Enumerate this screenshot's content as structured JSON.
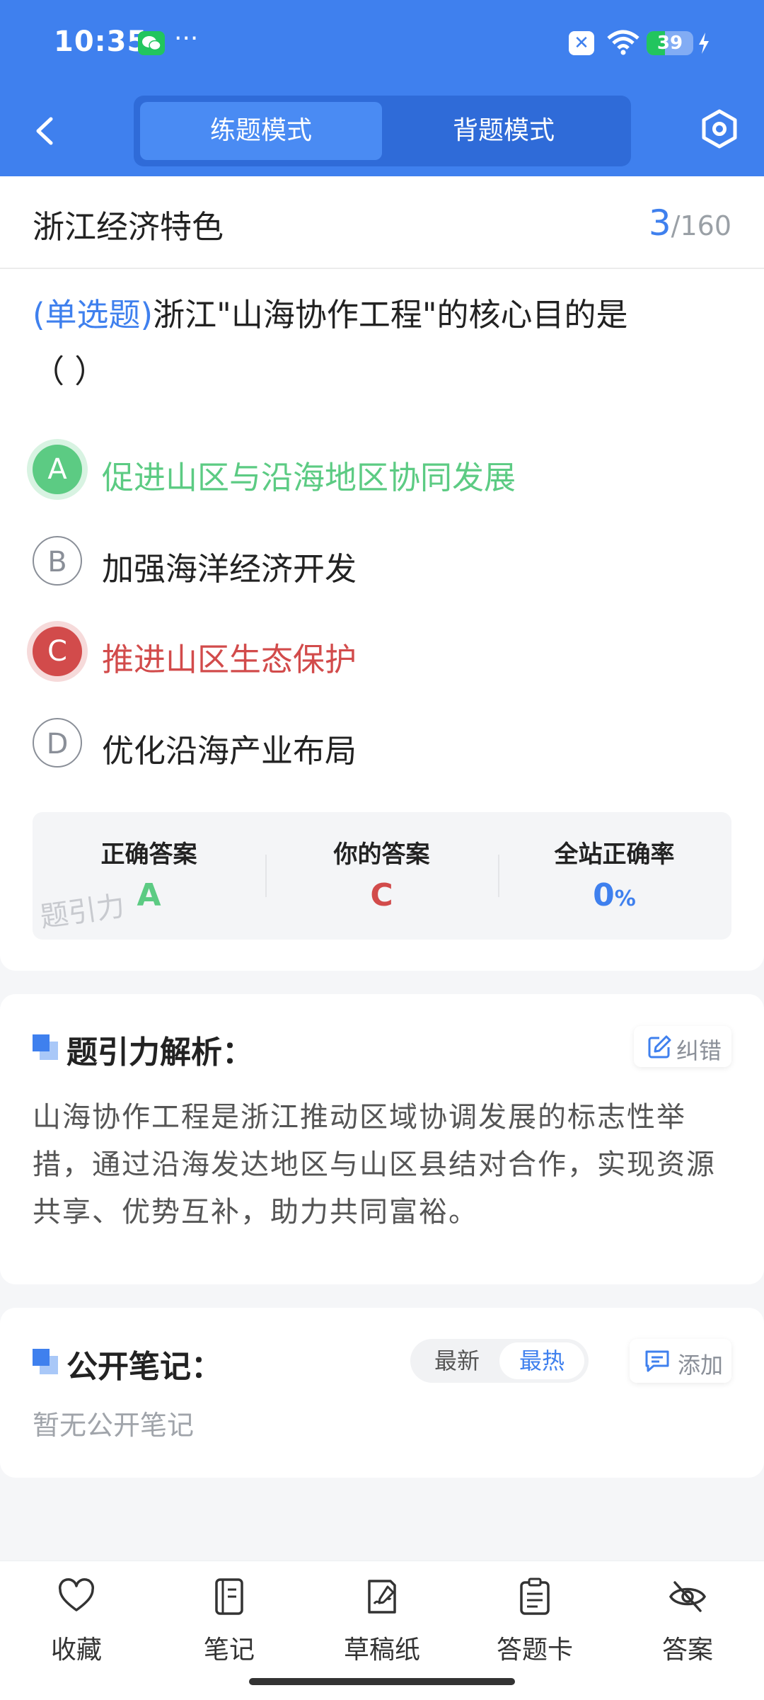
{
  "status_bar": {
    "time": "10:35",
    "battery_level": "39",
    "battery_percent": 39,
    "icons": [
      "wechat-icon",
      "more-dots-icon",
      "close-badge-icon",
      "wifi-icon",
      "battery-icon",
      "charging-bolt-icon"
    ]
  },
  "header": {
    "back_icon": "chevron-left-icon",
    "mode_tabs": [
      {
        "label": "练题模式",
        "active": true
      },
      {
        "label": "背题模式",
        "active": false
      }
    ],
    "settings_icon": "hexagon-settings-icon"
  },
  "chapter": {
    "title": "浙江经济特色",
    "current": "3",
    "separator": "/",
    "total": "160"
  },
  "question": {
    "type_label": "(单选题)",
    "text_line1": "浙江\"山海协作工程\"的核心目的是",
    "text_line2": "（        ）",
    "options": [
      {
        "letter": "A",
        "text": "促进山区与沿海地区协同发展",
        "state": "correct"
      },
      {
        "letter": "B",
        "text": "加强海洋经济开发",
        "state": "normal"
      },
      {
        "letter": "C",
        "text": "推进山区生态保护",
        "state": "wrong"
      },
      {
        "letter": "D",
        "text": "优化沿海产业布局",
        "state": "normal"
      }
    ]
  },
  "answer_summary": {
    "correct_label": "正确答案",
    "correct_value": "A",
    "yours_label": "你的答案",
    "yours_value": "C",
    "rate_label": "全站正确率",
    "rate_value": "0",
    "rate_unit": "%",
    "watermark": "题引力"
  },
  "analysis": {
    "title": "题引力解析：",
    "report_label": "纠错",
    "text": "山海协作工程是浙江推动区域协调发展的标志性举措，通过沿海发达地区与山区县结对合作，实现资源共享、优势互补，助力共同富裕。"
  },
  "notes": {
    "title": "公开笔记：",
    "sort_latest": "最新",
    "sort_hottest": "最热",
    "add_label": "添加",
    "empty_text": "暂无公开笔记"
  },
  "bottom_nav": [
    {
      "label": "收藏",
      "icon": "heart-icon"
    },
    {
      "label": "笔记",
      "icon": "notebook-icon"
    },
    {
      "label": "草稿纸",
      "icon": "draft-paper-icon"
    },
    {
      "label": "答题卡",
      "icon": "answer-card-icon"
    },
    {
      "label": "答案",
      "icon": "eye-off-icon"
    }
  ],
  "colors": {
    "primary": "#3f80ee",
    "correct": "#5ccb83",
    "wrong": "#d24b4b"
  }
}
